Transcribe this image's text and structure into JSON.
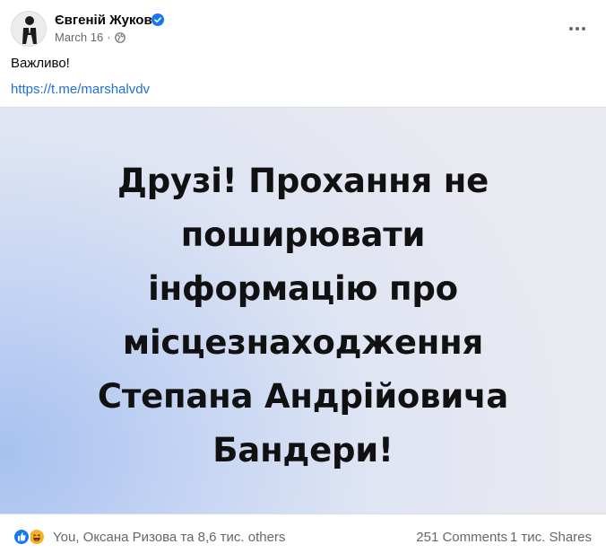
{
  "post": {
    "author": "Євгеній Жуков",
    "date": "March 16",
    "separator": "·",
    "text": "Важливо!",
    "link": "https://t.me/marshalvdv"
  },
  "image": {
    "lines": [
      "Друзі! Прохання не",
      "поширювати",
      "інформацію про",
      "місцезнаходження",
      "Степана Андрійовича",
      "Бандери!"
    ]
  },
  "footer": {
    "reactions_text": "You, Оксана Ризова та 8,6 тис. others",
    "comments": "251 Comments",
    "shares": "1 тис. Shares"
  },
  "colors": {
    "link": "#216fdb",
    "verified": "#1877f2",
    "muted": "#65676b"
  },
  "icons": [
    "avatar-person",
    "verified-badge-icon",
    "globe-icon",
    "more-dots-icon",
    "like-reaction-icon",
    "haha-reaction-icon"
  ]
}
